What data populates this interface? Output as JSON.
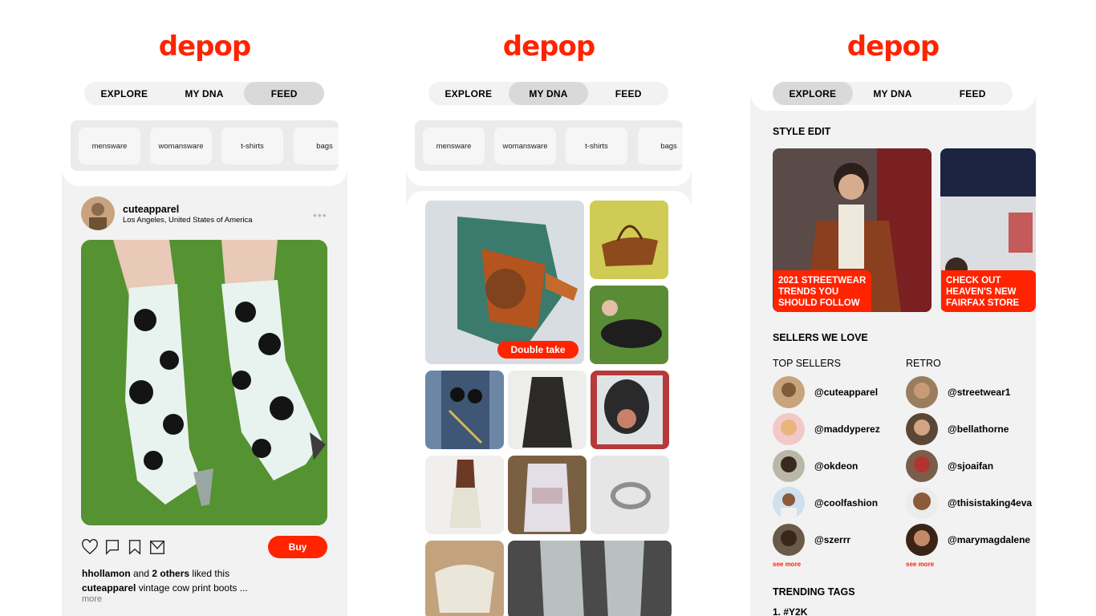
{
  "brand": {
    "logo_text": "depop",
    "color": "#ff2300"
  },
  "tabs": [
    "EXPLORE",
    "MY DNA",
    "FEED"
  ],
  "categories": [
    "mensware",
    "womansware",
    "t-shirts",
    "bags"
  ],
  "feed": {
    "active_tab": "FEED",
    "user": {
      "name": "cuteapparel",
      "location": "Los Angeles, United States of America"
    },
    "menu_dots": "•••",
    "buy_label": "Buy",
    "likes": {
      "user": "hhollamon",
      "connector": " and ",
      "others": "2 others",
      "suffix": " liked this"
    },
    "caption": {
      "user": "cuteapparel",
      "text": " vintage cow print boots ..."
    },
    "more_label": "more",
    "icons": [
      "heart-icon",
      "comment-icon",
      "bookmark-icon",
      "share-icon"
    ]
  },
  "dna": {
    "active_tab": "MY DNA",
    "double_take_label": "Double take"
  },
  "explore": {
    "active_tab": "EXPLORE",
    "style_edit_title": "STYLE EDIT",
    "style_cards": [
      {
        "label": "2021 STREETWEAR TRENDS YOU SHOULD FOLLOW"
      },
      {
        "label": "CHECK OUT HEAVEN'S NEW FAIRFAX STORE"
      }
    ],
    "sellers_title": "SELLERS WE LOVE",
    "top_sellers_title": "TOP SELLERS",
    "retro_title": "RETRO",
    "top_sellers": [
      "@cuteapparel",
      "@maddyperez",
      "@okdeon",
      "@coolfashion",
      "@szerrr"
    ],
    "retro_sellers": [
      "@streetwear1",
      "@bellathorne",
      "@sjoaifan",
      "@thisistaking4eva",
      "@marymagdalene"
    ],
    "see_more_label": "see more",
    "trending_title": "TRENDING TAGS",
    "trending_first": "1. #Y2K"
  }
}
